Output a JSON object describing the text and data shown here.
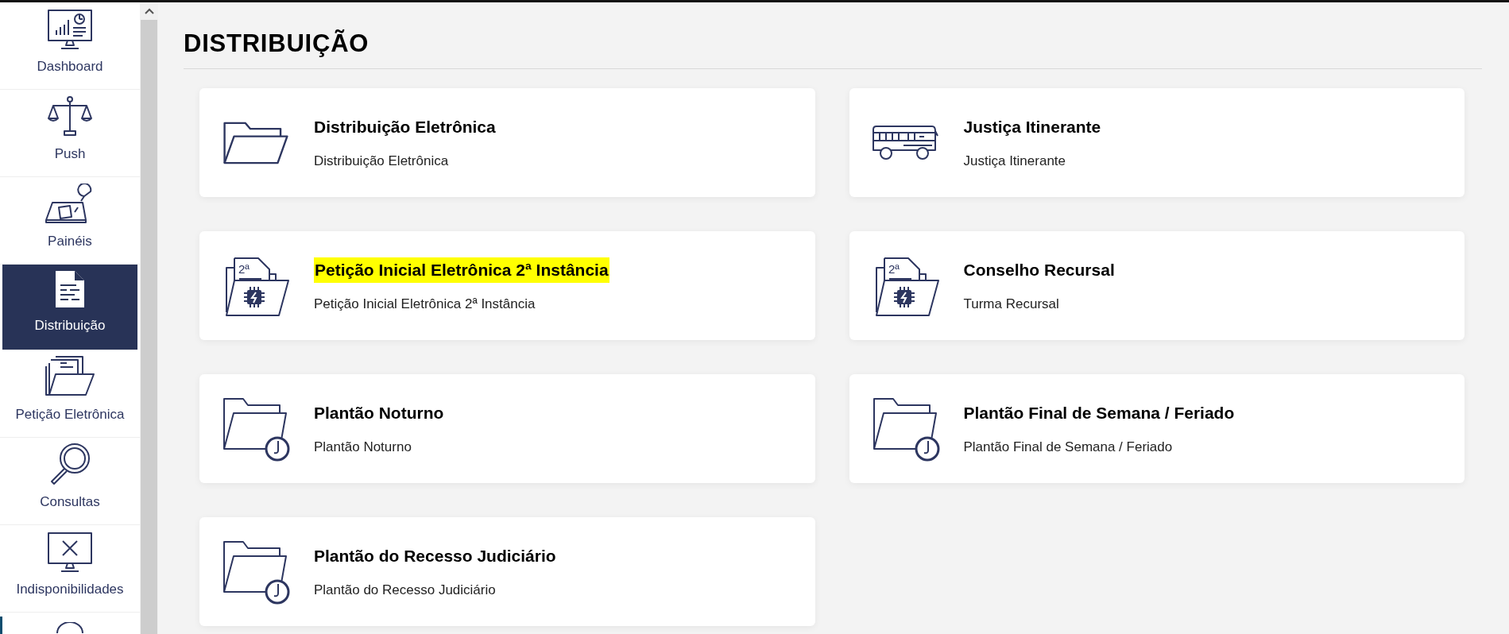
{
  "sidebar": {
    "items": [
      {
        "label": "Dashboard",
        "kind": "dashboard",
        "selected": false
      },
      {
        "label": "Push",
        "kind": "scales",
        "selected": false
      },
      {
        "label": "Painéis",
        "kind": "desk",
        "selected": false
      },
      {
        "label": "Distribuição",
        "kind": "document",
        "selected": true
      },
      {
        "label": "Petição Eletrônica",
        "kind": "files",
        "selected": false
      },
      {
        "label": "Consultas",
        "kind": "magnifier",
        "selected": false
      },
      {
        "label": "Indisponibilidades",
        "kind": "monitor",
        "selected": false
      }
    ]
  },
  "page": {
    "title": "DISTRIBUIÇÃO"
  },
  "cards": [
    {
      "title": "Distribuição Eletrônica",
      "subtitle": "Distribuição Eletrônica",
      "kind": "folder",
      "highlighted": false
    },
    {
      "title": "Justiça Itinerante",
      "subtitle": "Justiça Itinerante",
      "kind": "bus",
      "highlighted": false
    },
    {
      "title": "Petição Inicial Eletrônica 2ª Instância",
      "subtitle": "Petição Inicial Eletrônica 2ª Instância",
      "kind": "document",
      "icon_label": "2ª",
      "highlighted": true
    },
    {
      "title": "Conselho Recursal",
      "subtitle": "Turma Recursal",
      "kind": "document",
      "icon_label": "2ª",
      "highlighted": false
    },
    {
      "title": "Plantão Noturno",
      "subtitle": "Plantão Noturno",
      "kind": "clock",
      "highlighted": false
    },
    {
      "title": "Plantão Final de Semana / Feriado",
      "subtitle": "Plantão Final de Semana / Feriado",
      "kind": "clock",
      "highlighted": false
    },
    {
      "title": "Plantão do Recesso Judiciário",
      "subtitle": "Plantão do Recesso Judiciário",
      "kind": "clock",
      "highlighted": false
    }
  ]
}
